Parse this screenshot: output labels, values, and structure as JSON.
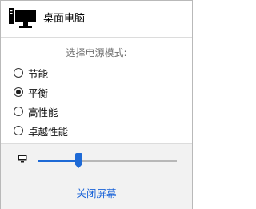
{
  "header": {
    "title": "桌面电脑",
    "icon": "desktop-computer-icon"
  },
  "power_mode": {
    "label": "选择电源模式:",
    "options": [
      {
        "label": "节能",
        "selected": false
      },
      {
        "label": "平衡",
        "selected": true
      },
      {
        "label": "高性能",
        "selected": false
      },
      {
        "label": "卓越性能",
        "selected": false
      }
    ]
  },
  "brightness": {
    "icon": "monitor-icon",
    "value_fraction": 0.29,
    "accent": "#1e6ad6"
  },
  "actions": {
    "close_screen": "关闭屏幕"
  }
}
